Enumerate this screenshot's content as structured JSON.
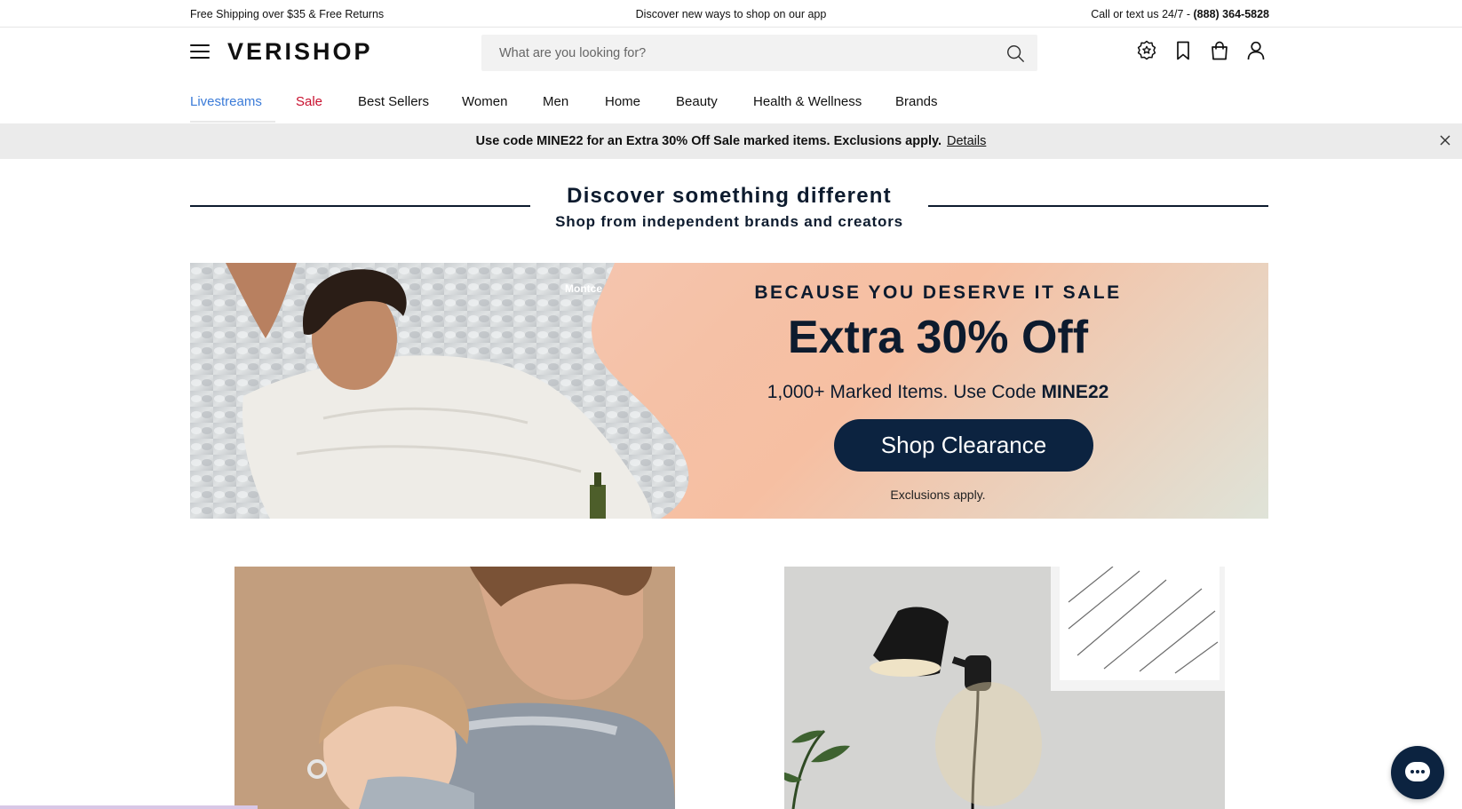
{
  "utility_bar": {
    "left_text": "Free Shipping over $35 & Free Returns",
    "center_text": "Discover new ways to shop on our app",
    "right_prefix": "Call or text us 24/7 - ",
    "right_phone": "(888) 364-5828"
  },
  "header": {
    "logo": "VERISHOP",
    "search_placeholder": "What are you looking for?",
    "icons": [
      "menu-icon",
      "search-icon",
      "rewards-badge-icon",
      "bookmark-icon",
      "shopping-bag-icon",
      "account-icon"
    ]
  },
  "nav": {
    "items": [
      {
        "label": "Livestreams",
        "state": "active"
      },
      {
        "label": "Sale",
        "state": "sale"
      },
      {
        "label": "Best Sellers"
      },
      {
        "label": "Women"
      },
      {
        "label": "Men"
      },
      {
        "label": "Home"
      },
      {
        "label": "Beauty"
      },
      {
        "label": "Health & Wellness"
      },
      {
        "label": "Brands"
      }
    ]
  },
  "promo_strip": {
    "message": "Use code MINE22 for an Extra 30% Off Sale marked items. Exclusions apply.",
    "details_link": "Details"
  },
  "discover": {
    "title": "Discover something different",
    "subtitle": "Shop from independent brands and creators"
  },
  "hero": {
    "brand_tag": "Montce",
    "eyebrow": "BECAUSE YOU DESERVE IT SALE",
    "headline": "Extra 30% Off",
    "sub_prefix": "1,000+ Marked Items. Use Code ",
    "sub_code": "MINE22",
    "cta": "Shop Clearance",
    "fine_print": "Exclusions apply."
  },
  "colors": {
    "active_nav": "#3b7bd8",
    "sale_nav": "#c8102e",
    "navy": "#0c2340",
    "promo_strip_bg": "#ebebeb"
  }
}
